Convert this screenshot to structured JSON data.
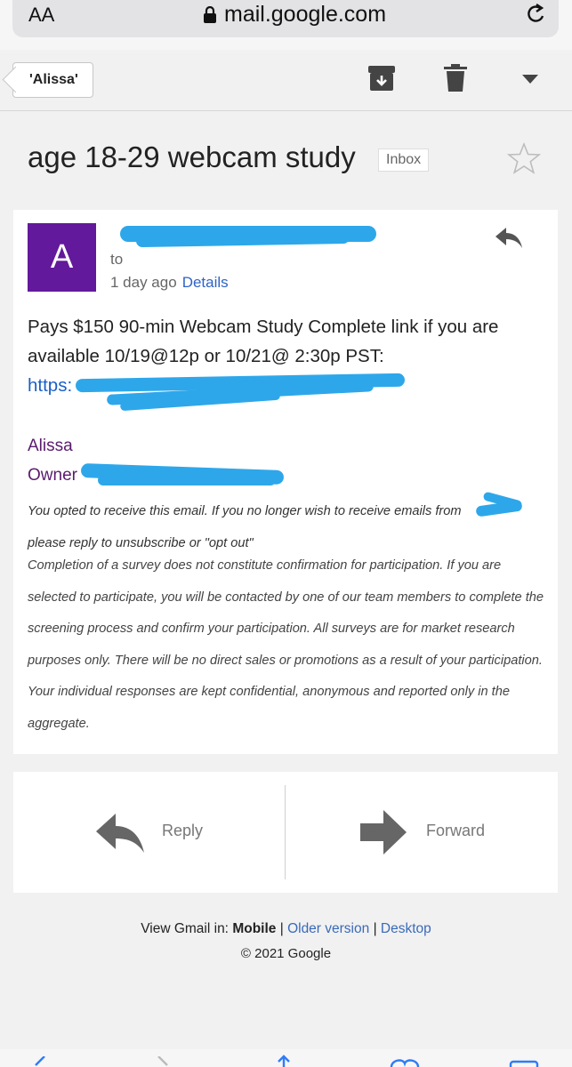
{
  "browser": {
    "aa_label": "AA",
    "url": "mail.google.com"
  },
  "toolbar": {
    "back_label": "'Alissa'"
  },
  "email": {
    "subject": "age 18-29 webcam study",
    "label_badge": "Inbox",
    "avatar_letter": "A",
    "to_label": "to",
    "date": "1 day ago",
    "details_label": "Details",
    "body": "Pays $150 90-min Webcam Study Complete link if you are available 10/19@12p or 10/21@ 2:30p PST:",
    "link_prefix": "https:",
    "signature_name": "Alissa",
    "signature_title": "Owner",
    "optout_text": "You opted to receive this email. If you no longer wish to receive emails from",
    "optout_text2": "please reply to unsubscribe or \"opt out\"",
    "disclaimer": "Completion of a survey does not constitute confirmation for participation. If you are selected to participate, you will be contacted by one of our team members to complete the screening process and confirm your participation. All surveys are for market research purposes only. There will be no direct sales or promotions as a result of your participation. Your individual responses are kept confidential, anonymous and reported only in the aggregate."
  },
  "actions": {
    "reply_label": "Reply",
    "forward_label": "Forward"
  },
  "footer": {
    "view_prefix": "View Gmail in:",
    "mobile": "Mobile",
    "sep": "|",
    "older": "Older version",
    "desktop": "Desktop",
    "copyright": "© 2021 Google"
  },
  "colors": {
    "avatar": "#63199b",
    "link": "#1a5fc8",
    "signature": "#5a1b6e",
    "redaction": "#2ea7ea"
  }
}
